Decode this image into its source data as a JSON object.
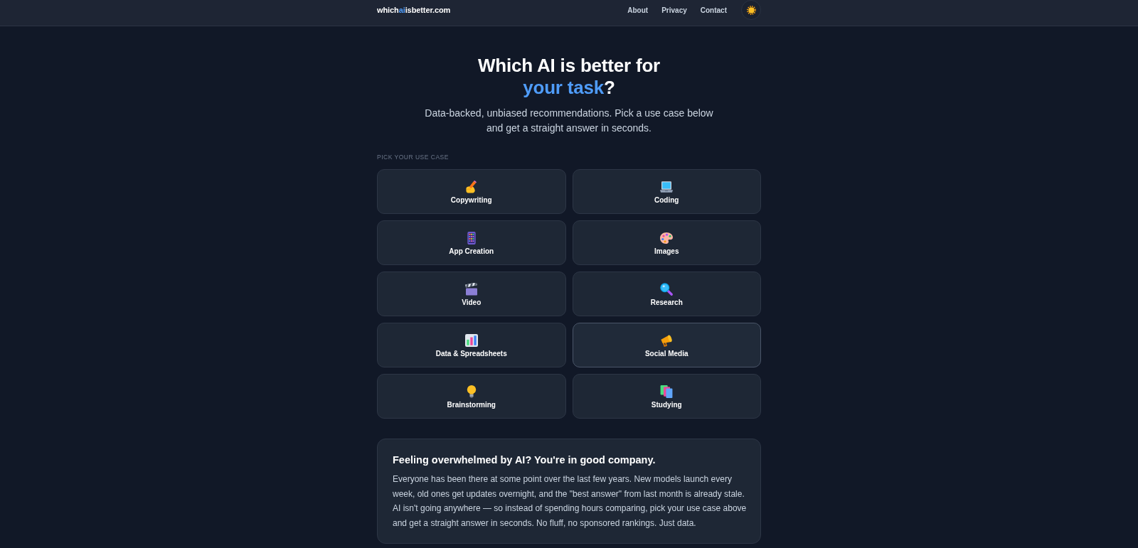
{
  "header": {
    "logo": {
      "before": "which",
      "highlight": "ai",
      "after": "isbetter.com"
    },
    "nav": [
      {
        "label": "About"
      },
      {
        "label": "Privacy"
      },
      {
        "label": "Contact"
      }
    ]
  },
  "hero": {
    "title": "Which AI is better for",
    "title_highlight": "your task",
    "title_end": "?",
    "subtitle": "Data-backed, unbiased recommendations. Pick a use case below and get a straight answer in seconds."
  },
  "use_cases": {
    "heading": "PICK YOUR USE CASE",
    "items": [
      {
        "label": "Copywriting",
        "hovered": false
      },
      {
        "label": "Coding",
        "hovered": false
      },
      {
        "label": "App Creation",
        "hovered": false
      },
      {
        "label": "Images",
        "hovered": false
      },
      {
        "label": "Video",
        "hovered": false
      },
      {
        "label": "Research",
        "hovered": false
      },
      {
        "label": "Data & Spreadsheets",
        "hovered": false
      },
      {
        "label": "Social Media",
        "hovered": true
      },
      {
        "label": "Brainstorming",
        "hovered": false
      },
      {
        "label": "Studying",
        "hovered": false
      }
    ]
  },
  "intro_card": {
    "title": "Feeling overwhelmed by AI? You're in good company.",
    "body": "Everyone has been there at some point over the last few years. New models launch every week, old ones get updates overnight, and the \"best answer\" from last month is already stale. AI isn't going anywhere — so instead of spending hours comparing, pick your use case above and get a straight answer in seconds. No fluff, no sponsored rankings. Just data."
  }
}
